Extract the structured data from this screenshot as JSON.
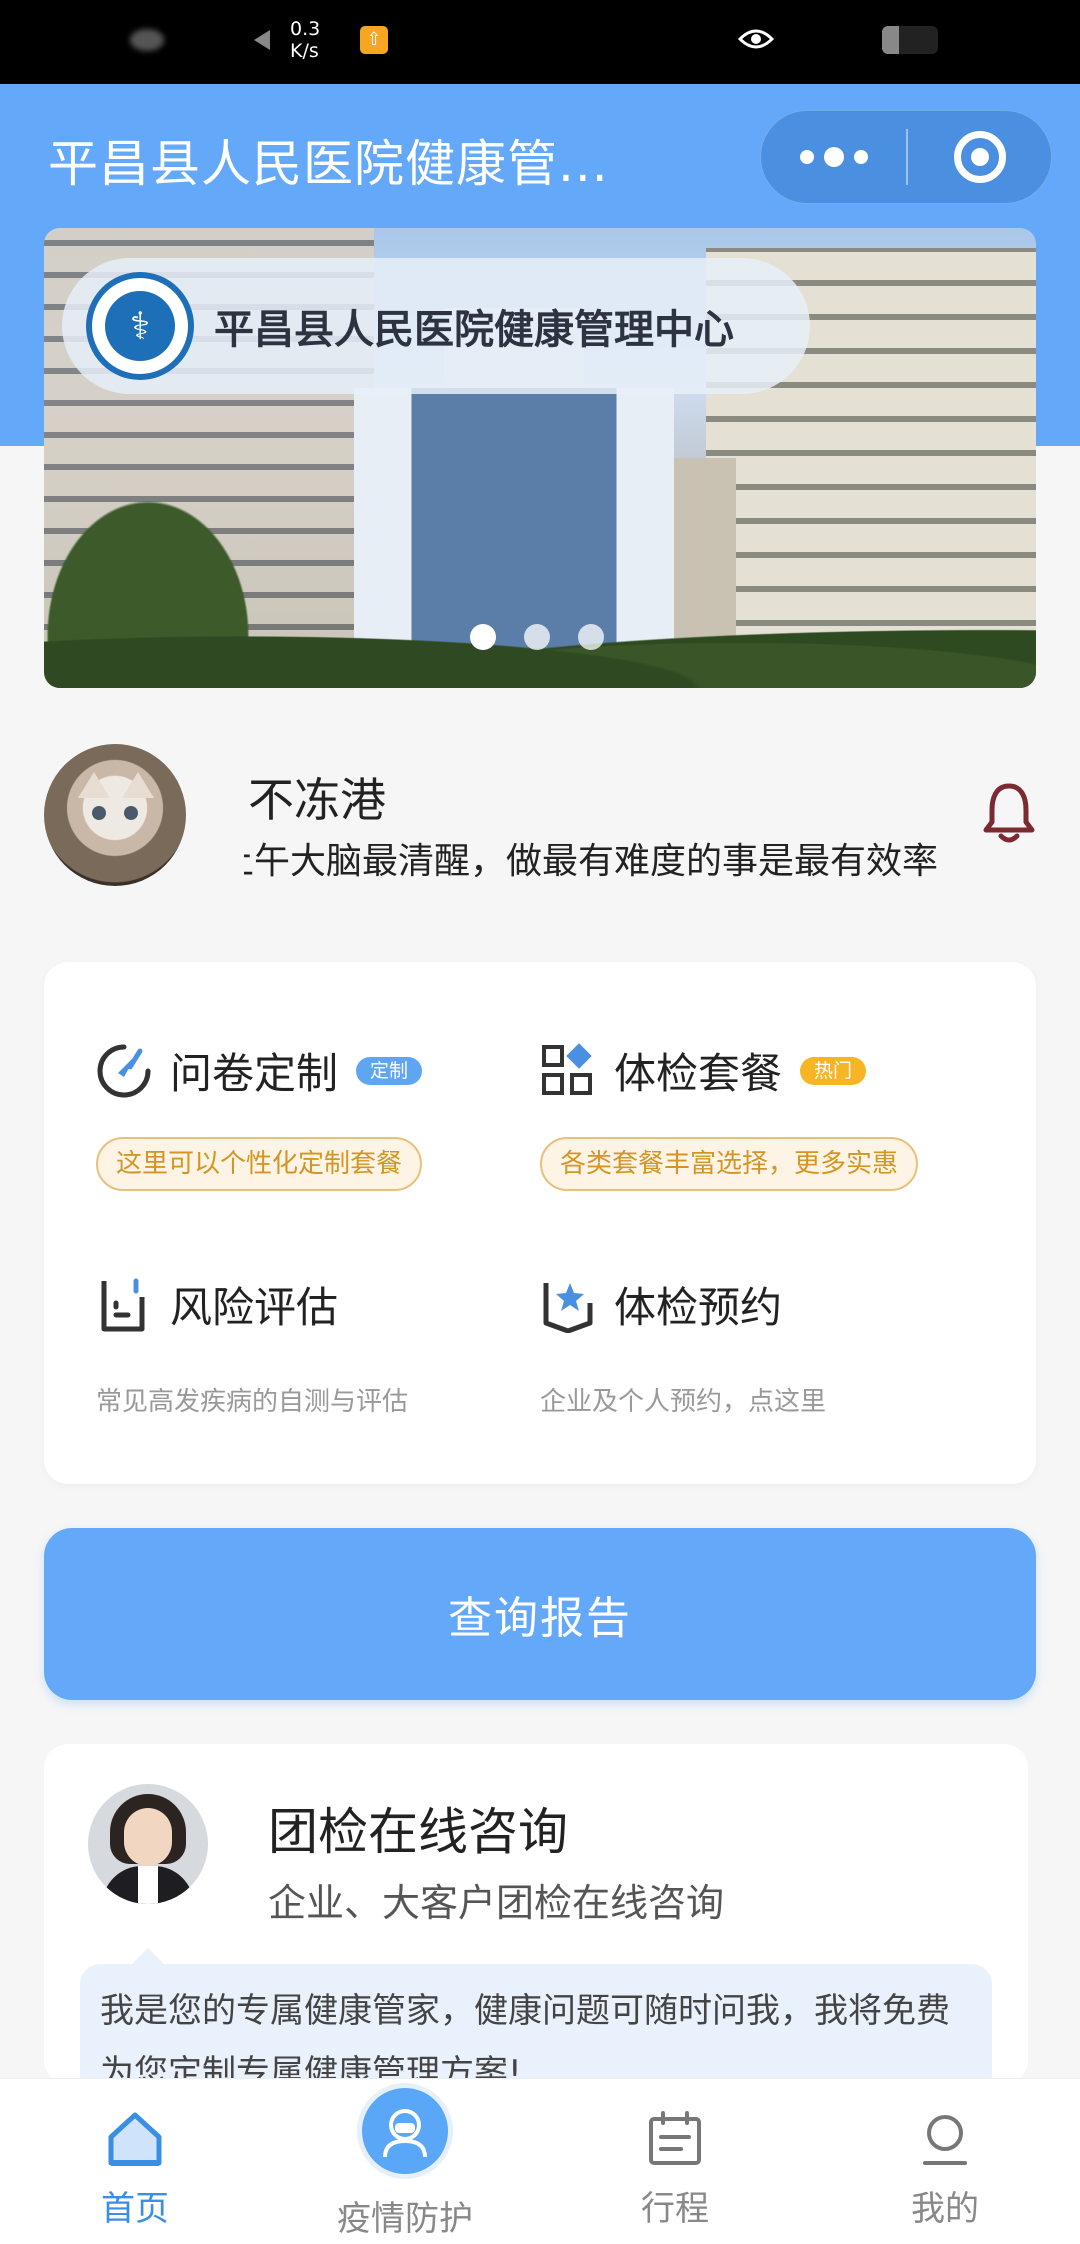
{
  "status_bar": {
    "speed_top": "0.3",
    "speed_unit": "K/s"
  },
  "header": {
    "title": "平昌县人民医院健康管..."
  },
  "banner": {
    "title": "平昌县人民医院健康管理中心",
    "dot_count": 3,
    "active_dot": 0
  },
  "profile": {
    "name": "不冻港",
    "motto": "上午大脑最清醒，做最有难度的事是最有效率"
  },
  "services": [
    {
      "title": "问卷定制",
      "tag": "定制",
      "tag_color": "#5fa5f2",
      "note": "这里可以个性化定制套餐",
      "icon": "compass-icon"
    },
    {
      "title": "体检套餐",
      "tag": "热门",
      "tag_color": "#f5b524",
      "note": "各类套餐丰富选择，更多实惠",
      "icon": "apps-grid-icon"
    },
    {
      "title": "风险评估",
      "note": "常见高发疾病的自测与评估",
      "icon": "document-chart-icon"
    },
    {
      "title": "体检预约",
      "note": "企业及个人预约，点这里",
      "icon": "star-bookmark-icon"
    }
  ],
  "query_button": {
    "label": "查询报告"
  },
  "consult": {
    "title": "团检在线咨询",
    "subtitle": "企业、大客户团检在线咨询",
    "message": "我是您的专属健康管家，健康问题可随时问我，我将免费为您定制专属健康管理方案!"
  },
  "tabbar": [
    {
      "label": "首页",
      "icon": "home-icon",
      "active": true
    },
    {
      "label": "疫情防护",
      "icon": "doctor-icon",
      "active": false
    },
    {
      "label": "行程",
      "icon": "calendar-icon",
      "active": false
    },
    {
      "label": "我的",
      "icon": "user-icon",
      "active": false
    }
  ],
  "colors": {
    "primary": "#64a9f9",
    "tag_blue": "#5fa5f2",
    "tag_orange": "#f5b524",
    "note_orange": "#d39624"
  }
}
